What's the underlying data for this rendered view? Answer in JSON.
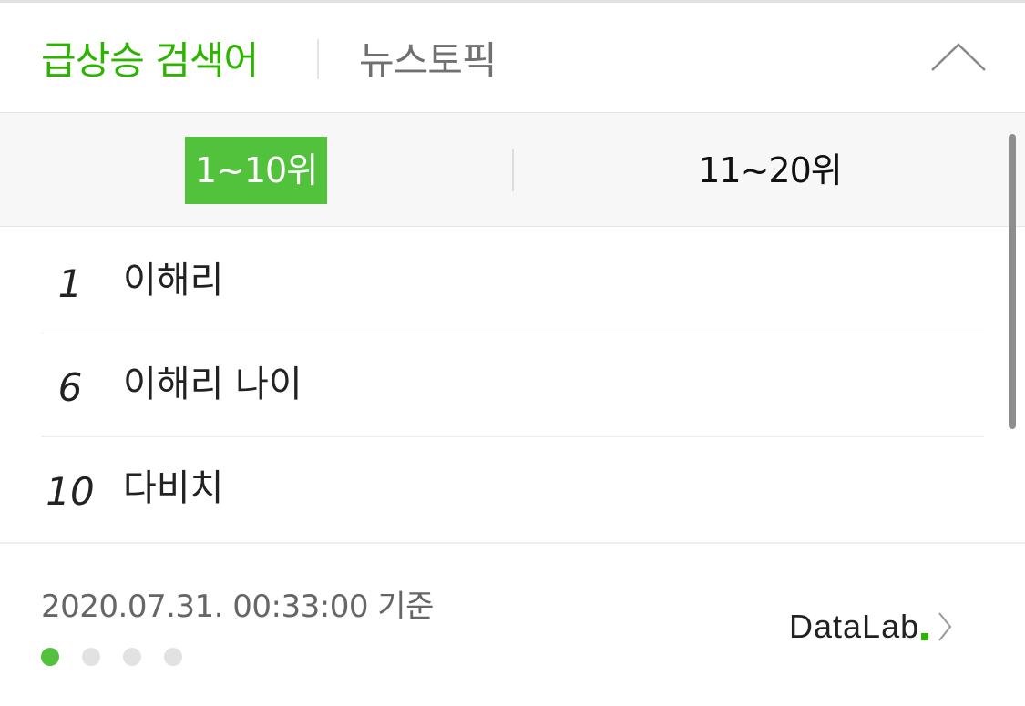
{
  "header": {
    "tabs": [
      {
        "label": "급상승 검색어",
        "active": true
      },
      {
        "label": "뉴스토픽",
        "active": false
      }
    ],
    "collapse_icon": "chevron-up-icon"
  },
  "ranges": [
    {
      "label": "1~10위",
      "selected": true
    },
    {
      "label": "11~20위",
      "selected": false
    }
  ],
  "keywords": [
    {
      "rank": "1",
      "text": "이해리"
    },
    {
      "rank": "6",
      "text": "이해리 나이"
    },
    {
      "rank": "10",
      "text": "다비치"
    }
  ],
  "footer": {
    "timestamp": "2020.07.31. 00:33:00 기준",
    "datalab_label": "DataLab",
    "datalab_dot": ".",
    "page_indicator": {
      "count": 4,
      "active_index": 0
    }
  },
  "colors": {
    "accent": "#2db400",
    "selected_bg": "#52c23d",
    "inactive_text": "#707070"
  }
}
